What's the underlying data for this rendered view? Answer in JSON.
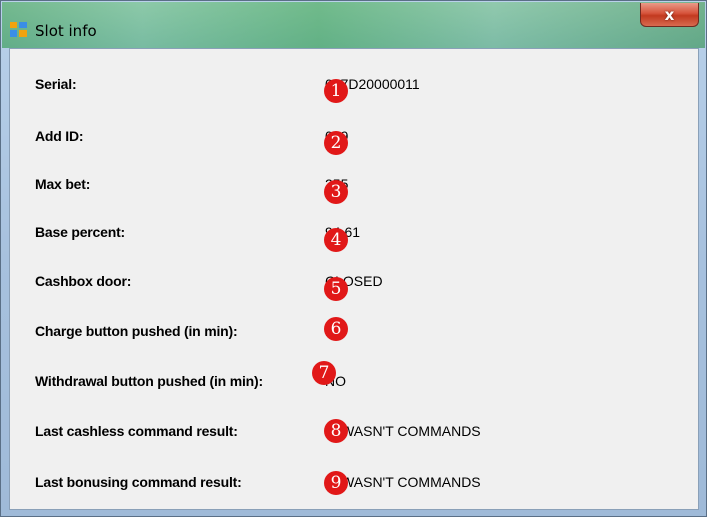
{
  "window": {
    "title": "Slot info",
    "close_label": "x"
  },
  "rows": [
    {
      "label": "Serial:",
      "value": "067D20000011",
      "badge": "1"
    },
    {
      "label": "Add ID:",
      "value": "099",
      "badge": "2"
    },
    {
      "label": "Max bet:",
      "value": "255",
      "badge": "3"
    },
    {
      "label": "Base percent:",
      "value": "94.61",
      "badge": "4"
    },
    {
      "label": "Cashbox door:",
      "value": "CLOSED",
      "badge": "5"
    },
    {
      "label": "Charge button pushed (in min):",
      "value": "NO",
      "badge": "6"
    },
    {
      "label": "Withdrawal button pushed (in min):",
      "value": "NO",
      "badge": "7"
    },
    {
      "label": "Last cashless command result:",
      "value": "IT WASN'T COMMANDS",
      "badge": "8"
    },
    {
      "label": "Last bonusing command result:",
      "value": "IT WASN'T COMMANDS",
      "badge": "9"
    }
  ],
  "colors": {
    "badge": "#e11818",
    "close_button": "#c2391f"
  },
  "icons": {
    "title": "app-window-icon",
    "close": "close-icon"
  }
}
